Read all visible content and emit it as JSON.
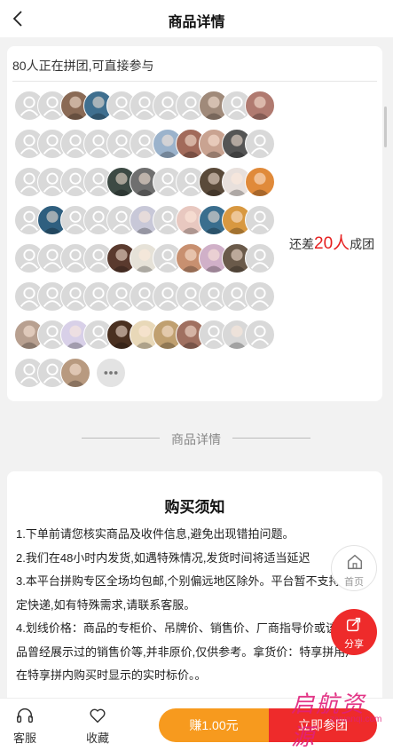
{
  "nav": {
    "title": "商品详情",
    "back_icon": "chevron-left-icon"
  },
  "group": {
    "header": "80人正在拼团,可直接参与",
    "remain_prefix": "还差",
    "remain_count": "20人",
    "remain_suffix": "成团",
    "more_icon": "ellipsis-icon"
  },
  "divider_label": "商品详情",
  "notice": {
    "title": "购买须知",
    "lines": [
      "1.下单前请您核实商品及收件信息,避免出现错拍问题。",
      "2.我们在48小时内发货,如遇特殊情况,发货时间将适当延迟",
      "3.本平台拼购专区全场均包邮,个别偏远地区除外。平台暂不支持指",
      "定快递,如有特殊需求,请联系客服。",
      "4.划线价格：商品的专柜价、吊牌价、销售价、厂商指导价或该商",
      "品曾经展示过的销售价等,并非原价,仅供参考。拿货价：特享拼用户",
      "在特享拼内购买时显示的实时标价。。"
    ]
  },
  "float": {
    "home_label": "首页",
    "share_label": "分享"
  },
  "tabbar": {
    "service_label": "客服",
    "favorite_label": "收藏",
    "earn_label": "赚1.00元",
    "join_label": "立即参团"
  },
  "watermark": {
    "main": "启航资源",
    "sub": "ziyuanqi.com"
  },
  "colors": {
    "accent": "#ee2b2b",
    "earn": "#f79a1e",
    "highlight": "#e62020"
  }
}
